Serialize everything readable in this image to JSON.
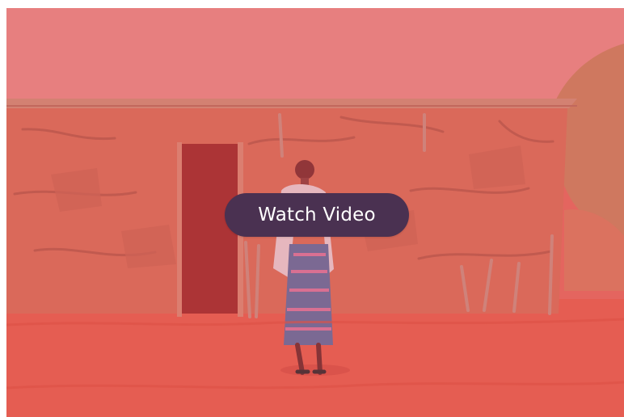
{
  "video": {
    "cta_label": "Watch Video",
    "overlay_color": "#e46a63",
    "button_color": "#4a3151",
    "icons": [
      "play-video-button"
    ]
  }
}
